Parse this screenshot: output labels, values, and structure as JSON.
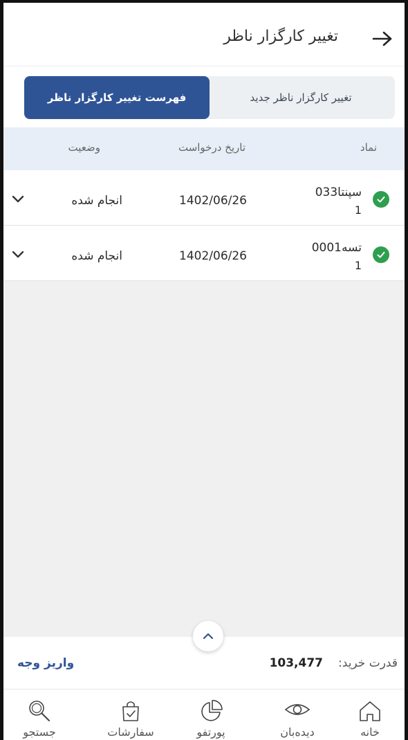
{
  "header": {
    "title": "تغییر کارگزار ناظر"
  },
  "tabs": [
    {
      "label": "تغییر کارگزار ناظر جدید",
      "active": false
    },
    {
      "label": "فهرست تغییر کارگزار ناظر",
      "active": true
    }
  ],
  "table": {
    "columns": [
      "نماد",
      "تاریخ درخواست",
      "وضعیت"
    ],
    "rows": [
      {
        "symbol": "سپنتا033",
        "symbol_suffix": "1",
        "date": "1402/06/26",
        "status": "انجام شده",
        "status_icon": "check-circle-icon"
      },
      {
        "symbol": "تسه0001",
        "symbol_suffix": "1",
        "date": "1402/06/26",
        "status": "انجام شده",
        "status_icon": "check-circle-icon"
      }
    ]
  },
  "footer": {
    "buying_power_label": "قدرت خرید:",
    "buying_power_value": "103,477",
    "deposit_label": "واریز وجه"
  },
  "nav": [
    {
      "label": "خانه",
      "icon": "home-icon"
    },
    {
      "label": "دیده‌بان",
      "icon": "eye-icon"
    },
    {
      "label": "پورتفو",
      "icon": "pie-chart-icon"
    },
    {
      "label": "سفارشات",
      "icon": "shopping-bag-icon"
    },
    {
      "label": "جستجو",
      "icon": "search-icon"
    }
  ],
  "colors": {
    "primary": "#2f5496",
    "success": "#2e9e4f",
    "header_row": "#e8eef7"
  }
}
